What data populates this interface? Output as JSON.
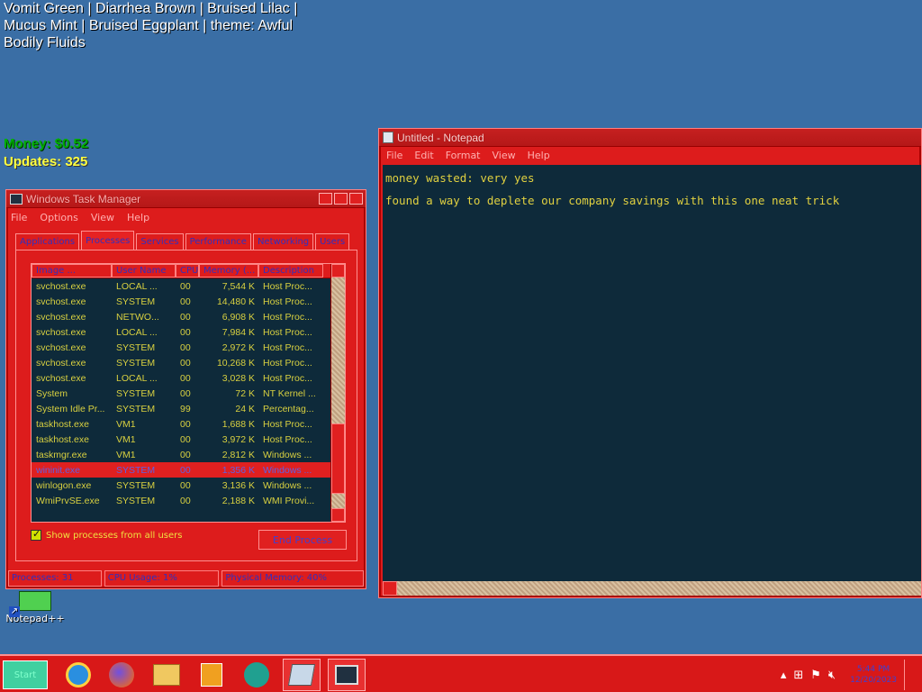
{
  "desktop": {
    "theme_label": "Vomit Green | Diarrhea Brown | Bruised Lilac | Mucus Mint | Bruised Eggplant | theme: Awful Bodily Fluids",
    "money_label": "Money: $0.52",
    "updates_label": "Updates: 325",
    "icon_label": "Notepad++"
  },
  "taskmgr": {
    "title": "Windows Task Manager",
    "menu": [
      "File",
      "Options",
      "View",
      "Help"
    ],
    "tabs": [
      "Applications",
      "Processes",
      "Services",
      "Performance",
      "Networking",
      "Users"
    ],
    "active_tab": 1,
    "columns": [
      "Image ...",
      "User Name",
      "CPU",
      "Memory (...",
      "Description"
    ],
    "rows": [
      {
        "name": "svchost.exe",
        "user": "LOCAL ...",
        "cpu": "00",
        "mem": "7,544 K",
        "desc": "Host Proc..."
      },
      {
        "name": "svchost.exe",
        "user": "SYSTEM",
        "cpu": "00",
        "mem": "14,480 K",
        "desc": "Host Proc..."
      },
      {
        "name": "svchost.exe",
        "user": "NETWO...",
        "cpu": "00",
        "mem": "6,908 K",
        "desc": "Host Proc..."
      },
      {
        "name": "svchost.exe",
        "user": "LOCAL ...",
        "cpu": "00",
        "mem": "7,984 K",
        "desc": "Host Proc..."
      },
      {
        "name": "svchost.exe",
        "user": "SYSTEM",
        "cpu": "00",
        "mem": "2,972 K",
        "desc": "Host Proc..."
      },
      {
        "name": "svchost.exe",
        "user": "SYSTEM",
        "cpu": "00",
        "mem": "10,268 K",
        "desc": "Host Proc..."
      },
      {
        "name": "svchost.exe",
        "user": "LOCAL ...",
        "cpu": "00",
        "mem": "3,028 K",
        "desc": "Host Proc..."
      },
      {
        "name": "System",
        "user": "SYSTEM",
        "cpu": "00",
        "mem": "72 K",
        "desc": "NT Kernel ..."
      },
      {
        "name": "System Idle Pr...",
        "user": "SYSTEM",
        "cpu": "99",
        "mem": "24 K",
        "desc": "Percentag..."
      },
      {
        "name": "taskhost.exe",
        "user": "VM1",
        "cpu": "00",
        "mem": "1,688 K",
        "desc": "Host Proc..."
      },
      {
        "name": "taskhost.exe",
        "user": "VM1",
        "cpu": "00",
        "mem": "3,972 K",
        "desc": "Host Proc..."
      },
      {
        "name": "taskmgr.exe",
        "user": "VM1",
        "cpu": "00",
        "mem": "2,812 K",
        "desc": "Windows ..."
      },
      {
        "name": "wininit.exe",
        "user": "SYSTEM",
        "cpu": "00",
        "mem": "1,356 K",
        "desc": "Windows ..."
      },
      {
        "name": "winlogon.exe",
        "user": "SYSTEM",
        "cpu": "00",
        "mem": "3,136 K",
        "desc": "Windows ..."
      },
      {
        "name": "WmiPrvSE.exe",
        "user": "SYSTEM",
        "cpu": "00",
        "mem": "2,188 K",
        "desc": "WMI Provi..."
      }
    ],
    "selected_row": 12,
    "show_all_label": "Show processes from all users",
    "end_process_label": "End Process",
    "status": [
      "Processes: 31",
      "CPU Usage: 1%",
      "Physical Memory: 40%"
    ]
  },
  "notepad": {
    "title": "Untitled - Notepad",
    "menu": [
      "File",
      "Edit",
      "Format",
      "View",
      "Help"
    ],
    "text": "money wasted: very yes\nfound a way to deplete our company savings with this one neat trick"
  },
  "taskbar": {
    "start_label": "Start",
    "icons": [
      "ie-icon",
      "firefox-icon",
      "explorer-icon",
      "media-player-icon",
      "chat-icon",
      "notepad-icon",
      "task-manager-icon"
    ],
    "clock_time": "5:44 PM",
    "clock_date": "12/20/2023"
  },
  "colors": {
    "desktop_bg": "#3a6ea5",
    "window_red": "#dd1c1c",
    "list_bg": "#0e2a3a",
    "list_text": "#d8d040",
    "link_blue": "#3030c0"
  }
}
